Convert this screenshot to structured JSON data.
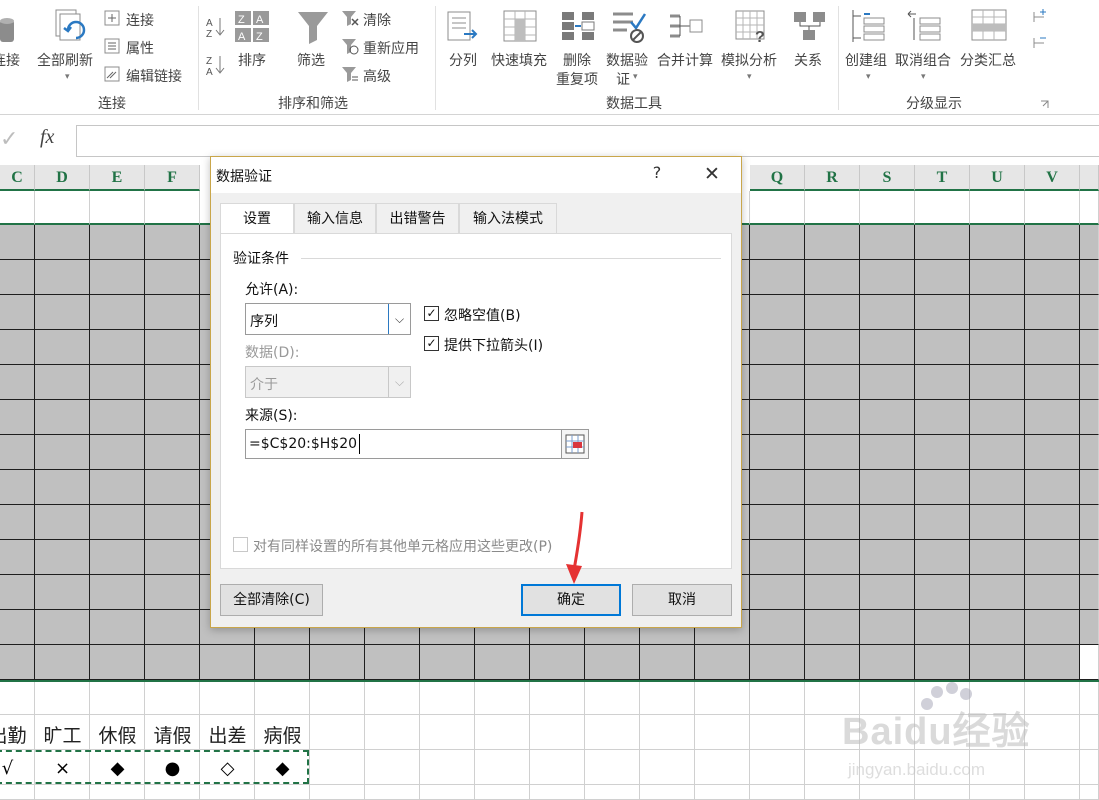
{
  "ribbon": {
    "connections": {
      "cut_label": "连接",
      "refresh_all": "全部刷新",
      "connections": "连接",
      "properties": "属性",
      "edit_links": "编辑链接",
      "group": "连接"
    },
    "sort_filter": {
      "sort": "排序",
      "filter": "筛选",
      "clear": "清除",
      "reapply": "重新应用",
      "advanced": "高级",
      "group": "排序和筛选"
    },
    "data_tools": {
      "text_to_columns": "分列",
      "flash_fill": "快速填充",
      "remove_duplicates_1": "删除",
      "remove_duplicates_2": "重复项",
      "data_validation_1": "数据验",
      "data_validation_2": "证",
      "consolidate": "合并计算",
      "what_if": "模拟分析",
      "relationships": "关系",
      "group": "数据工具"
    },
    "outline": {
      "group_btn": "创建组",
      "ungroup": "取消组合",
      "subtotal": "分类汇总",
      "group": "分级显示"
    }
  },
  "formula_bar": {
    "fx": "fx",
    "value": ""
  },
  "columns": [
    "C",
    "D",
    "E",
    "F",
    "Q",
    "R",
    "S",
    "T",
    "U",
    "V"
  ],
  "legend": {
    "labels": [
      "出勤",
      "旷工",
      "休假",
      "请假",
      "出差",
      "病假"
    ],
    "symbols": [
      "√",
      "×",
      "◆",
      "●",
      "◇",
      "◆"
    ]
  },
  "dialog": {
    "title": "数据验证",
    "help": "?",
    "close": "✕",
    "tabs": [
      "设置",
      "输入信息",
      "出错警告",
      "输入法模式"
    ],
    "section": "验证条件",
    "allow_label": "允许(A):",
    "allow_value": "序列",
    "data_label": "数据(D):",
    "data_value": "介于",
    "source_label": "来源(S):",
    "source_value": "=$C$20:$H$20",
    "ignore_blank": "忽略空值(B)",
    "ignore_blank_checked": true,
    "dropdown_arrow": "提供下拉箭头(I)",
    "dropdown_arrow_checked": true,
    "apply_all": "对有同样设置的所有其他单元格应用这些更改(P)",
    "apply_all_checked": false,
    "clear_all": "全部清除(C)",
    "ok": "确定",
    "cancel": "取消"
  },
  "watermark": {
    "brand": "Baidu经验",
    "url": "jingyan.baidu.com"
  }
}
